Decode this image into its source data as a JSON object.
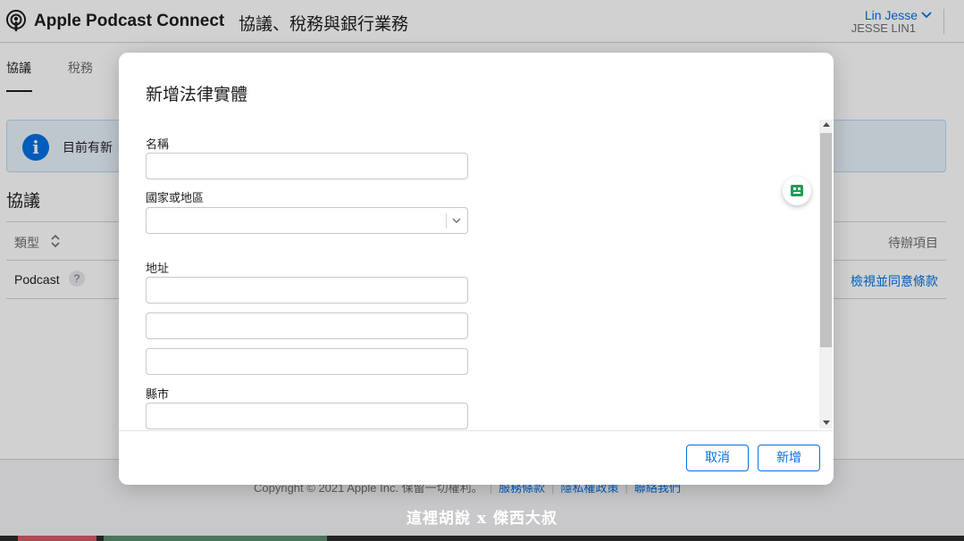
{
  "header": {
    "app_title": "Apple Podcast Connect",
    "section_title": "協議、稅務與銀行業務",
    "user_name": "Lin Jesse",
    "account_name": "JESSE LIN1"
  },
  "tabs": [
    {
      "label": "協議",
      "active": true
    },
    {
      "label": "稅務",
      "active": false
    }
  ],
  "banner": {
    "text": "目前有新"
  },
  "agreements": {
    "heading": "協議",
    "columns": {
      "type": "類型",
      "todo": "待辦項目"
    },
    "rows": [
      {
        "type": "Podcast",
        "help": "?",
        "action": "檢視並同意條款"
      }
    ]
  },
  "footer": {
    "copyright": "Copyright © 2021 Apple Inc. 保留一切權利。",
    "links": [
      "服務條款",
      "隱私權政策",
      "聯絡我們"
    ]
  },
  "watermark": "這裡胡說 x 傑西大叔",
  "modal": {
    "title": "新增法律實體",
    "fields": {
      "name": {
        "label": "名稱",
        "value": ""
      },
      "country": {
        "label": "國家或地區",
        "value": ""
      },
      "address": {
        "label": "地址",
        "line1": "",
        "line2": "",
        "line3": ""
      },
      "city": {
        "label": "縣市",
        "value": ""
      }
    },
    "buttons": {
      "cancel": "取消",
      "add": "新增"
    }
  },
  "colors": {
    "accent": "#0071e3",
    "extension": "#1f9d55"
  }
}
